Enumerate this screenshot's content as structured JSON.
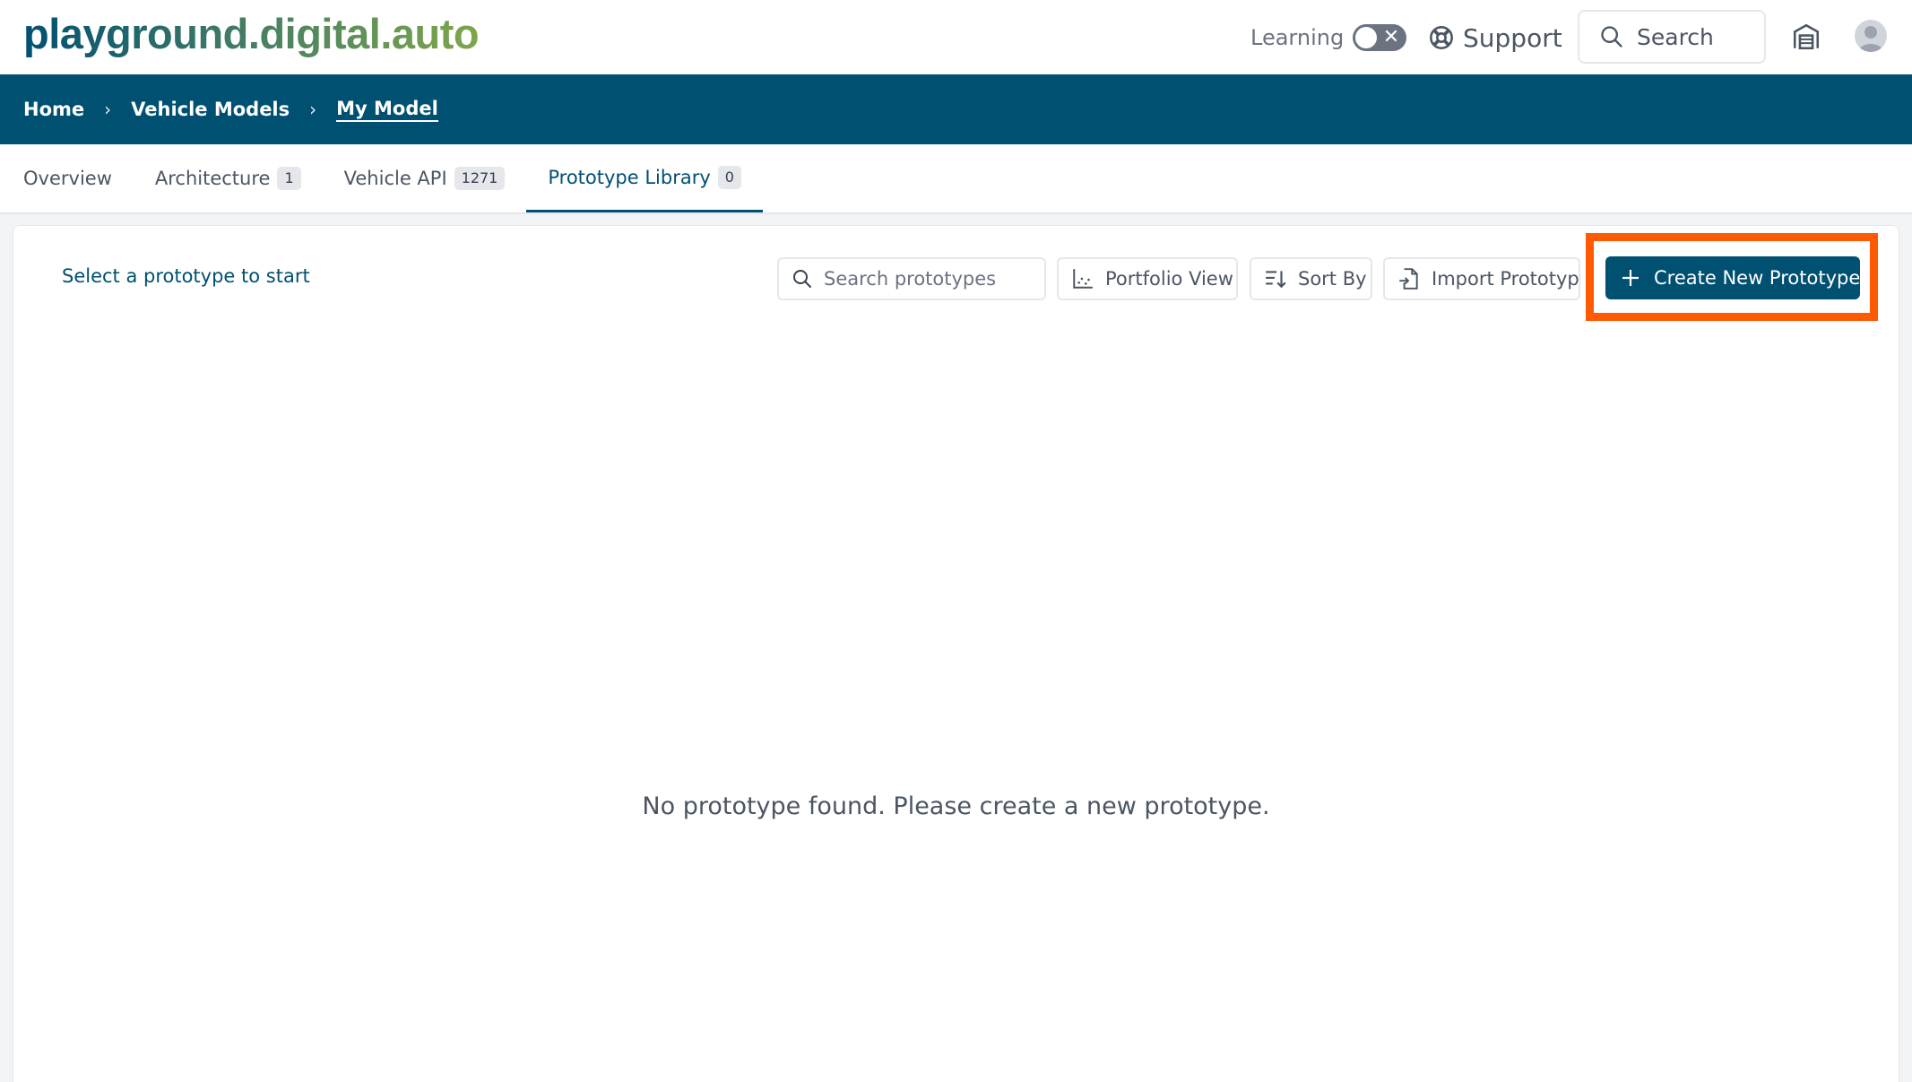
{
  "header": {
    "logo": "playground.digital.auto",
    "learning_label": "Learning",
    "support_label": "Support",
    "search_label": "Search"
  },
  "breadcrumb": {
    "items": [
      "Home",
      "Vehicle Models",
      "My Model"
    ]
  },
  "tabs": [
    {
      "label": "Overview",
      "badge": ""
    },
    {
      "label": "Architecture",
      "badge": "1"
    },
    {
      "label": "Vehicle API",
      "badge": "1271"
    },
    {
      "label": "Prototype Library",
      "badge": "0"
    }
  ],
  "library": {
    "select_hint": "Select a prototype to start",
    "search_placeholder": "Search prototypes",
    "portfolio_view": "Portfolio View",
    "sort_by": "Sort By",
    "import_prototype": "Import Prototype",
    "create_new": "Create New Prototype",
    "empty_message": "No prototype found. Please create a new prototype."
  },
  "colors": {
    "brand": "#005072",
    "highlight": "#ff5a00"
  }
}
